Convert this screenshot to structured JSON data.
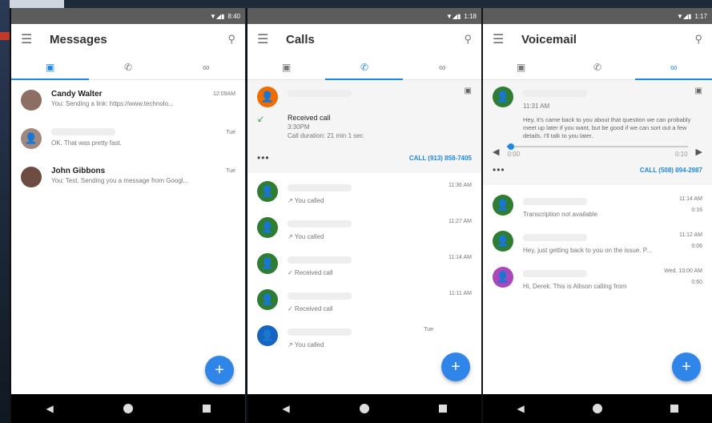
{
  "messages_screen": {
    "status_time": "8:40",
    "title": "Messages",
    "tabs": [
      "▣",
      "✆",
      "∞"
    ],
    "conversations": [
      {
        "name": "Candy Walter",
        "snippet": "You: Sending a link: https://www.technolo...",
        "time": "12:09AM",
        "avatar_color": "#8d6e63"
      },
      {
        "name": "",
        "snippet": "OK. That was pretty fast.",
        "time": "Tue",
        "avatar_color": "#a1887f"
      },
      {
        "name": "John Gibbons",
        "snippet": "You: Test. Sending you a message from Googl...",
        "time": "Tue",
        "avatar_color": "#6d4c41"
      }
    ],
    "fab": "+"
  },
  "calls_screen": {
    "status_time": "1:18",
    "title": "Calls",
    "tabs": [
      "▣",
      "✆",
      "∞"
    ],
    "expanded_call": {
      "title": "Received call",
      "time": "3:30PM",
      "duration": "Call duration: 21 min 1 sec",
      "call_button": "CALL (913) 858-7405",
      "dots": "•••"
    },
    "calls": [
      {
        "status": "↗ You called",
        "time": "11:36 AM",
        "avatar_color": "#2e7d32"
      },
      {
        "status": "↗ You called",
        "time": "11:27 AM",
        "avatar_color": "#2e7d32"
      },
      {
        "status": "✓ Received call",
        "time": "11:14 AM",
        "avatar_color": "#2e7d32"
      },
      {
        "status": "✓ Received call",
        "time": "11:11 AM",
        "avatar_color": "#2e7d32"
      },
      {
        "status": "↗ You called",
        "time": "Tue",
        "avatar_color": "#1565c0"
      }
    ],
    "fab": "+"
  },
  "voicemail_screen": {
    "status_time": "1:17",
    "title": "Voicemail",
    "tabs": [
      "▣",
      "✆",
      "∞"
    ],
    "expanded_voicemail": {
      "time": "11:31 AM",
      "text": "Hey, it's came back to you about that question we can probably meet up later if you want, but be good if we can sort out a few details. I'll talk to you later.",
      "start": "0:00",
      "end": "0:10",
      "call_button": "CALL (508) 894-2987",
      "dots": "•••",
      "progress": 0.02
    },
    "voicemails": [
      {
        "snippet": "Transcription not available",
        "time": "11:14 AM",
        "duration": "0:16",
        "avatar_color": "#2e7d32"
      },
      {
        "snippet": "Hey, just getting back to you on the issue. P...",
        "time": "11:12 AM",
        "duration": "0:06",
        "avatar_color": "#2e7d32"
      },
      {
        "snippet": "Hi, Derek. This is Allison calling from",
        "time": "Wed, 10:00 AM",
        "duration": "0:60",
        "avatar_color": "#ab47bc"
      }
    ],
    "fab": "+"
  }
}
